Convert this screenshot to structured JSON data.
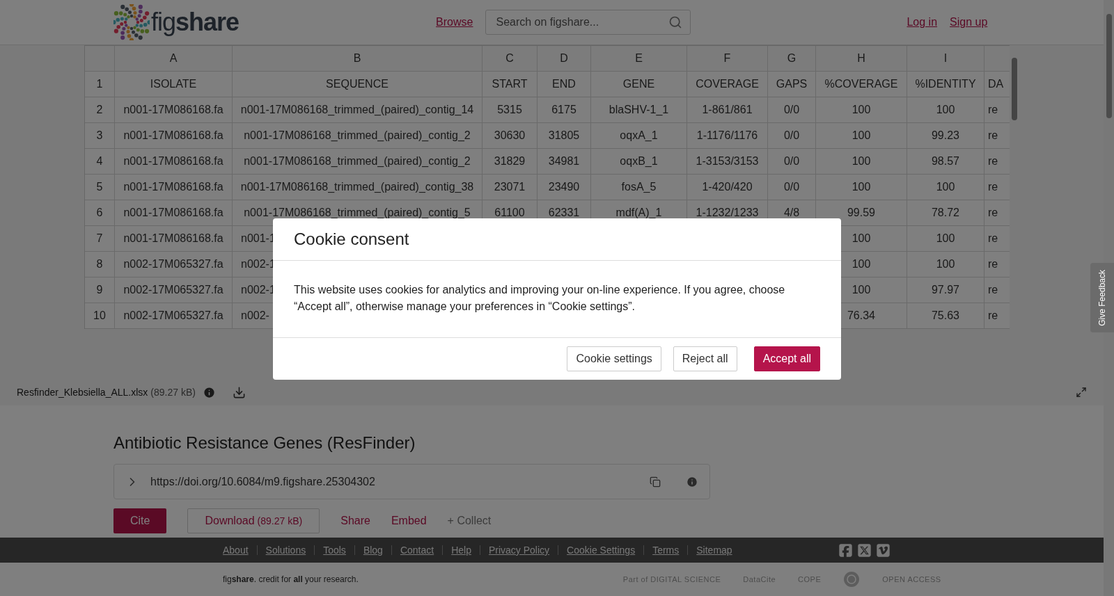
{
  "header": {
    "logo_text": "fig**share**",
    "browse": "Browse",
    "search": {
      "placeholder": "Search on figshare..."
    },
    "links": [
      "Log in",
      "Sign up"
    ]
  },
  "spreadsheet": {
    "columns": [
      "A",
      "B",
      "C",
      "D",
      "E",
      "F",
      "G",
      "H",
      "I"
    ],
    "rows": [
      {
        "number": "1",
        "cells": [
          "ISOLATE",
          "SEQUENCE",
          "START",
          "END",
          "GENE",
          "COVERAGE",
          "GAPS",
          "%COVERAGE",
          "%IDENTITY",
          "DA"
        ]
      },
      {
        "number": "2",
        "cells": [
          "n001-17M086168.fa",
          "n001-17M086168_trimmed_(paired)_contig_14",
          "5315",
          "6175",
          "blaSHV-1_1",
          "1-861/861",
          "0/0",
          "100",
          "100",
          "re"
        ]
      },
      {
        "number": "3",
        "cells": [
          "n001-17M086168.fa",
          "n001-17M086168_trimmed_(paired)_contig_2",
          "30630",
          "31805",
          "oqxA_1",
          "1-1176/1176",
          "0/0",
          "100",
          "99.23",
          "re"
        ]
      },
      {
        "number": "4",
        "cells": [
          "n001-17M086168.fa",
          "n001-17M086168_trimmed_(paired)_contig_2",
          "31829",
          "34981",
          "oqxB_1",
          "1-3153/3153",
          "0/0",
          "100",
          "98.57",
          "re"
        ]
      },
      {
        "number": "5",
        "cells": [
          "n001-17M086168.fa",
          "n001-17M086168_trimmed_(paired)_contig_38",
          "23071",
          "23490",
          "fosA_5",
          "1-420/420",
          "0/0",
          "100",
          "100",
          "re"
        ]
      },
      {
        "number": "6",
        "cells": [
          "n001-17M086168.fa",
          "n001-17M086168_trimmed_(paired)_contig_5",
          "61100",
          "62331",
          "mdf(A)_1",
          "1-1232/1233",
          "4/8",
          "99.59",
          "78.72",
          "re"
        ]
      },
      {
        "number": "7",
        "cells": [
          "n001-17M086168.fa",
          "n001-1",
          null,
          null,
          null,
          null,
          null,
          "100",
          "100",
          "re"
        ]
      },
      {
        "number": "8",
        "cells": [
          "n002-17M065327.fa",
          "n002-1",
          null,
          null,
          null,
          null,
          null,
          "100",
          "100",
          "re"
        ]
      },
      {
        "number": "9",
        "cells": [
          "n002-17M065327.fa",
          "n002-1",
          null,
          null,
          null,
          null,
          null,
          "100",
          "97.97",
          "re"
        ]
      },
      {
        "number": "10",
        "cells": [
          "n002-17M065327.fa",
          "n002-",
          null,
          null,
          null,
          null,
          null,
          "76.34",
          "75.63",
          "re"
        ]
      }
    ]
  },
  "file_bar": {
    "filename": "Resfinder_Klebsiella_ALL.xlsx",
    "size": "(89.27 kB)"
  },
  "item": {
    "title": "Antibiotic Resistance Genes (ResFinder)",
    "doi": "https://doi.org/10.6084/m9.figshare.25304302",
    "actions": [
      {
        "kind": "primary",
        "label": "Cite"
      },
      {
        "kind": "outlined",
        "label": "Download",
        "extra": "(89.27 kB)"
      },
      {
        "kind": "link",
        "label": "Share"
      },
      {
        "kind": "link",
        "label": "Embed"
      },
      {
        "kind": "muted",
        "label": "+ Collect"
      }
    ]
  },
  "footer": {
    "links": [
      "About",
      "Solutions",
      "Tools",
      "Blog",
      "Contact",
      "Help",
      "Privacy Policy",
      "Cookie Settings",
      "Terms",
      "Sitemap"
    ],
    "tagline": "fig**share**. credit for **all** your research.",
    "partners": [
      {
        "kind": "text",
        "label": "Part of DIGITAL SCIENCE"
      },
      {
        "kind": "text",
        "label": "DataCite"
      },
      {
        "kind": "text",
        "label": "COPE"
      },
      {
        "kind": "seal"
      },
      {
        "kind": "text",
        "label": "OPEN ACCESS"
      }
    ]
  },
  "feedback_tab": "Give Feedback",
  "cookie_modal": {
    "title": "Cookie consent",
    "body": "This website uses cookies for analytics and improving your on-line experience. If you agree, choose “Accept all”, otherwise manage your preferences in “Cookie settings”.",
    "buttons": [
      {
        "kind": "secondary",
        "label": "Cookie settings"
      },
      {
        "kind": "secondary",
        "label": "Reject all"
      },
      {
        "kind": "primary",
        "label": "Accept all"
      }
    ]
  }
}
